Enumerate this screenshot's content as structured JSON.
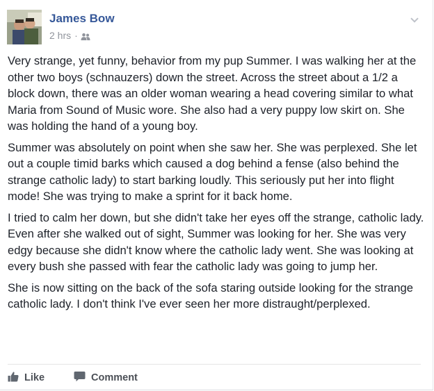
{
  "post": {
    "author": "James Bow",
    "timestamp": "2 hrs",
    "separator": "·",
    "privacy_icon": "friends-icon",
    "menu_icon": "chevron-down-icon",
    "paragraphs": [
      "Very strange, yet funny, behavior from my pup Summer. I was walking her at the other two boys (schnauzers) down the street. Across the street about a 1/2 a block down, there was an older woman wearing a head covering similar to what Maria from Sound of Music wore. She also had a very puppy low skirt on. She was holding the hand of a young boy.",
      "Summer was absolutely on point when she saw her. She was perplexed. She let out a couple timid barks which caused a dog behind a fense (also behind the strange catholic lady) to start barking loudly. This seriously put her into flight mode! She was trying to make a sprint for it back home.",
      "I tried to calm her down, but she didn't take her eyes off the strange, catholic lady. Even after she walked out of sight, Summer was looking for her. She was very edgy because she didn't know where the catholic lady went. She was looking at every bush she passed with fear the catholic lady was going to jump her.",
      "She is now sitting on the back of the sofa staring outside looking for the strange catholic lady. I don't think I've ever seen her more distraught/perplexed."
    ]
  },
  "actions": {
    "like_label": "Like",
    "like_icon": "thumbs-up-icon",
    "comment_label": "Comment",
    "comment_icon": "speech-bubble-icon"
  },
  "colors": {
    "author_link": "#365899",
    "meta_text": "#90949c",
    "body_text": "#1d2129",
    "action_text": "#4b4f56"
  }
}
